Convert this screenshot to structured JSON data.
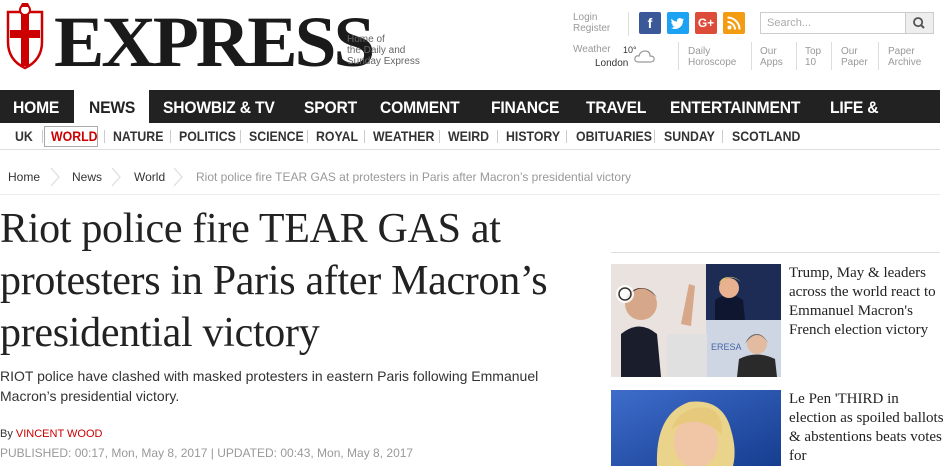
{
  "brand": {
    "name": "EXPRESS",
    "tagline_lines": [
      "Home of",
      "the Daily and",
      "Sunday Express"
    ]
  },
  "account": {
    "login": "Login",
    "register": "Register"
  },
  "social": [
    {
      "icon": "facebook-icon",
      "glyph": "f",
      "color": "#3b5998"
    },
    {
      "icon": "twitter-icon",
      "glyph": "t",
      "color": "#1da1f2"
    },
    {
      "icon": "google-plus-icon",
      "glyph": "G+",
      "color": "#dd4b39"
    },
    {
      "icon": "rss-icon",
      "glyph": "",
      "color": "#f39c12"
    }
  ],
  "search": {
    "placeholder": "Search..."
  },
  "weather": {
    "label": "Weather",
    "temp": "10°",
    "city": "London"
  },
  "utility_links": [
    {
      "line1": "Daily",
      "line2": "Horoscope"
    },
    {
      "line1": "Our",
      "line2": "Apps"
    },
    {
      "line1": "Top",
      "line2": "10"
    },
    {
      "line1": "Our",
      "line2": "Paper"
    },
    {
      "line1": "Paper",
      "line2": "Archive"
    }
  ],
  "main_nav": [
    "HOME",
    "NEWS",
    "SHOWBIZ & TV",
    "SPORT",
    "COMMENT",
    "FINANCE",
    "TRAVEL",
    "ENTERTAINMENT",
    "LIFE & STYLE"
  ],
  "main_nav_active": "NEWS",
  "sub_nav": [
    "UK",
    "WORLD",
    "NATURE",
    "POLITICS",
    "SCIENCE",
    "ROYAL",
    "WEATHER",
    "WEIRD",
    "HISTORY",
    "OBITUARIES",
    "SUNDAY",
    "SCOTLAND"
  ],
  "sub_nav_active": "WORLD",
  "breadcrumb": [
    "Home",
    "News",
    "World",
    "Riot police fire TEAR GAS at protesters in Paris after Macron’s presidential victory"
  ],
  "article": {
    "headline_lines": [
      "Riot police fire TEAR GAS at",
      "protesters in Paris after Macron’s",
      "presidential victory"
    ],
    "standfirst": "RIOT police have clashed with masked protesters in eastern Paris following Emmanuel Macron’s presidential victory.",
    "by_prefix": "By",
    "author": "VINCENT WOOD",
    "published": "PUBLISHED: 00:17, Mon, May 8, 2017 | UPDATED: 00:43, Mon, May 8, 2017"
  },
  "sidebar": [
    {
      "title": "Trump, May & leaders across the world react to Emmanuel Macron's French election victory",
      "image_text": "ERESA"
    },
    {
      "title": "Le Pen 'THIRD in election as spoiled ballots & abstentions beats votes for",
      "image_text": ""
    }
  ],
  "colors": {
    "accent": "#cc0000",
    "nav_bg": "#222222"
  }
}
